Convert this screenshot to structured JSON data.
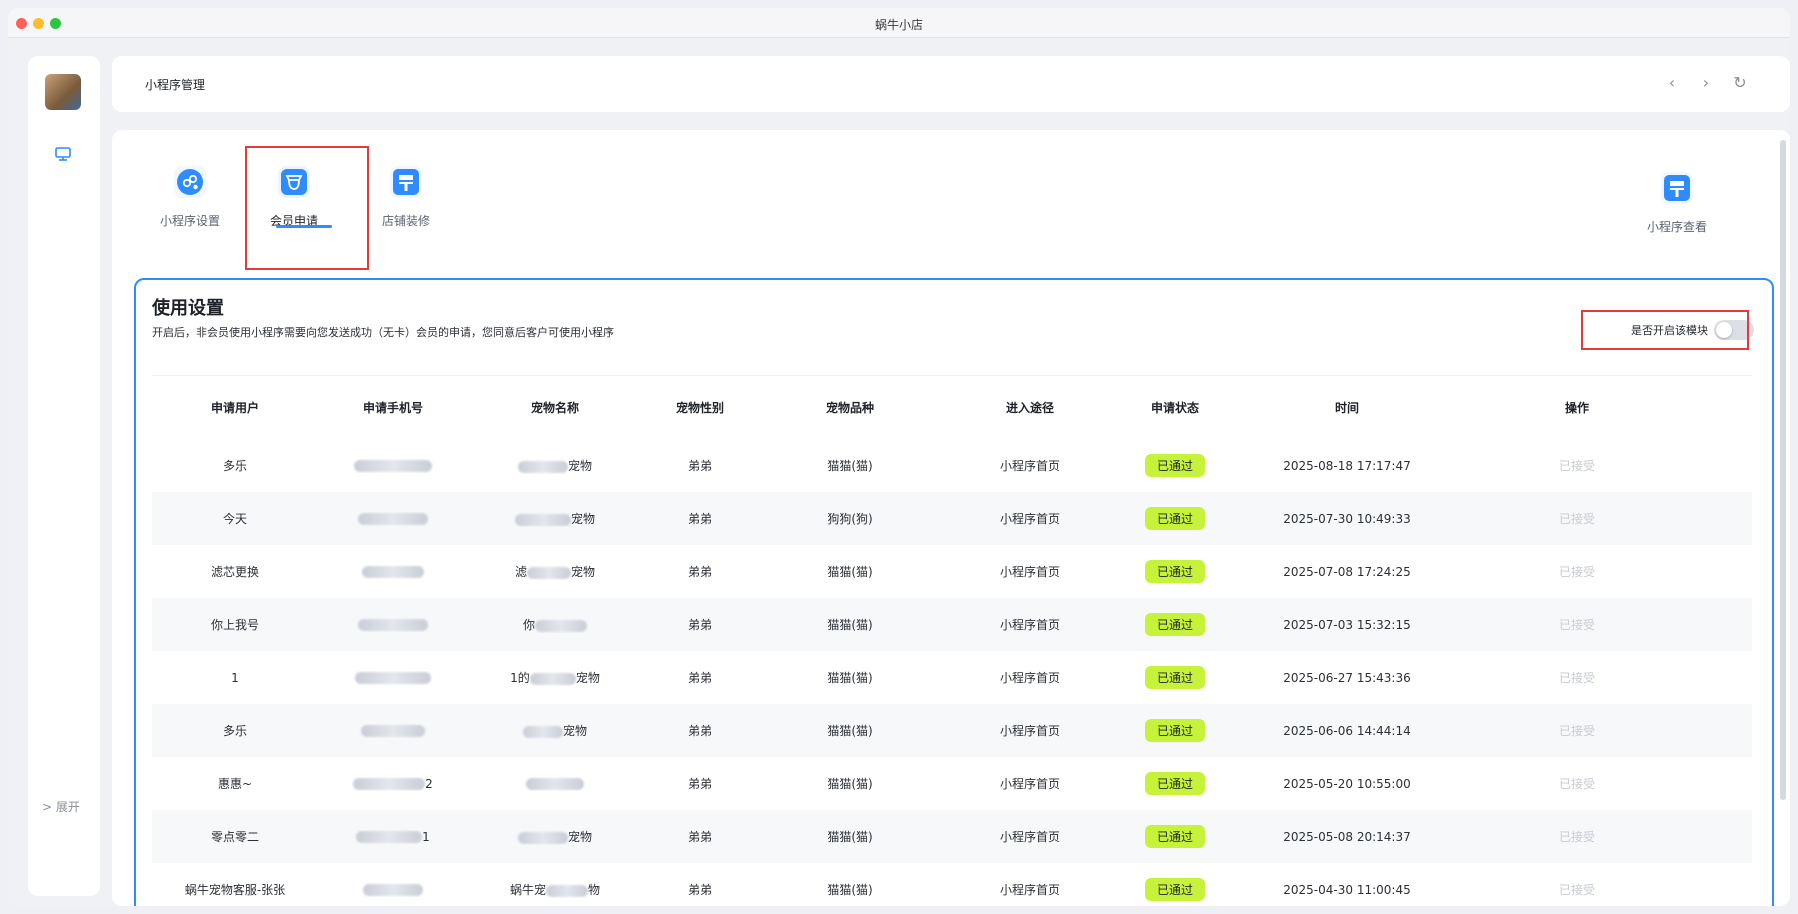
{
  "window": {
    "title": "蜗牛小店"
  },
  "sidebar": {
    "expand_label": "> 展开"
  },
  "topbar": {
    "title": "小程序管理",
    "back": "‹",
    "forward": "›",
    "refresh": "↻"
  },
  "tabs": [
    {
      "label": "小程序设置",
      "icon": "mini-program-settings-icon"
    },
    {
      "label": "会员申请",
      "icon": "member-application-icon",
      "active": true
    },
    {
      "label": "店铺装修",
      "icon": "store-decoration-icon"
    },
    {
      "label": "小程序查看",
      "icon": "mini-program-view-icon"
    }
  ],
  "section": {
    "title": "使用设置",
    "description": "开启后，非会员使用小程序需要向您发送成功（无卡）会员的申请，您同意后客户可使用小程序",
    "toggle_label": "是否开启该模块",
    "toggle_on": false
  },
  "table": {
    "headers": [
      "申请用户",
      "申请手机号",
      "宠物名称",
      "宠物性别",
      "宠物品种",
      "进入途径",
      "申请状态",
      "时间",
      "操作"
    ],
    "rows": [
      {
        "user": "多乐",
        "phone_suffix": "",
        "pet_prefix": "",
        "pet_suffix": "宠物",
        "gender": "弟弟",
        "breed": "猫猫(猫)",
        "source": "小程序首页",
        "status": "已通过",
        "time": "2025-08-18 17:17:47",
        "op": "已接受"
      },
      {
        "user": "今天",
        "phone_suffix": "",
        "pet_prefix": "",
        "pet_suffix": "宠物",
        "gender": "弟弟",
        "breed": "狗狗(狗)",
        "source": "小程序首页",
        "status": "已通过",
        "time": "2025-07-30 10:49:33",
        "op": "已接受"
      },
      {
        "user": "滤芯更换",
        "phone_suffix": "",
        "pet_prefix": "滤",
        "pet_suffix": "宠物",
        "gender": "弟弟",
        "breed": "猫猫(猫)",
        "source": "小程序首页",
        "status": "已通过",
        "time": "2025-07-08 17:24:25",
        "op": "已接受"
      },
      {
        "user": "你上我号",
        "phone_suffix": "",
        "pet_prefix": "你",
        "pet_suffix": "",
        "gender": "弟弟",
        "breed": "猫猫(猫)",
        "source": "小程序首页",
        "status": "已通过",
        "time": "2025-07-03 15:32:15",
        "op": "已接受"
      },
      {
        "user": "1",
        "phone_suffix": "",
        "pet_prefix": "1的",
        "pet_suffix": "宠物",
        "gender": "弟弟",
        "breed": "猫猫(猫)",
        "source": "小程序首页",
        "status": "已通过",
        "time": "2025-06-27 15:43:36",
        "op": "已接受"
      },
      {
        "user": "多乐",
        "phone_suffix": "",
        "pet_prefix": "",
        "pet_suffix": "宠物",
        "gender": "弟弟",
        "breed": "猫猫(猫)",
        "source": "小程序首页",
        "status": "已通过",
        "time": "2025-06-06 14:44:14",
        "op": "已接受"
      },
      {
        "user": "惠惠~",
        "phone_suffix": "2",
        "pet_prefix": "",
        "pet_suffix": "",
        "gender": "弟弟",
        "breed": "猫猫(猫)",
        "source": "小程序首页",
        "status": "已通过",
        "time": "2025-05-20 10:55:00",
        "op": "已接受"
      },
      {
        "user": "零点零二",
        "phone_suffix": "1",
        "pet_prefix": "",
        "pet_suffix": "宠物",
        "gender": "弟弟",
        "breed": "猫猫(猫)",
        "source": "小程序首页",
        "status": "已通过",
        "time": "2025-05-08 20:14:37",
        "op": "已接受"
      },
      {
        "user": "蜗牛宠物客服-张张",
        "phone_suffix": "",
        "pet_prefix": "蜗牛宠",
        "pet_suffix": "物",
        "gender": "弟弟",
        "breed": "猫猫(猫)",
        "source": "小程序首页",
        "status": "已通过",
        "time": "2025-04-30 11:00:45",
        "op": "已接受"
      }
    ]
  },
  "colors": {
    "accent": "#2f8cff",
    "status_badge": "#c6f23a",
    "annotation": "#e23b3b"
  }
}
